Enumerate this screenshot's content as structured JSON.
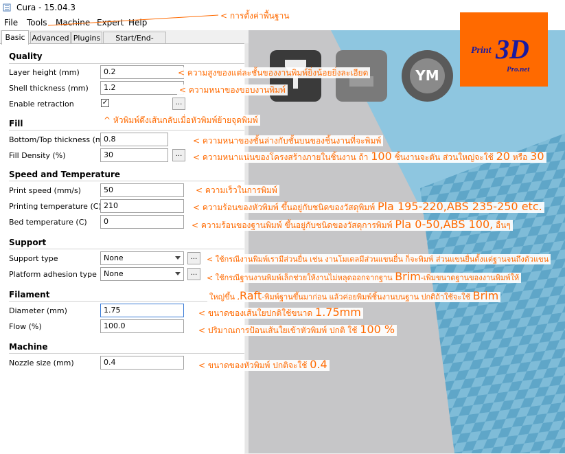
{
  "window": {
    "title": "Cura - 15.04.3"
  },
  "menu": [
    "File",
    "Tools",
    "Machine",
    "Expert",
    "Help"
  ],
  "tabs": [
    "Basic",
    "Advanced",
    "Plugins",
    "Start/End-GCode"
  ],
  "sections": {
    "quality": {
      "title": "Quality",
      "layer_height": {
        "label": "Layer height (mm)",
        "value": "0.2"
      },
      "shell_thickness": {
        "label": "Shell thickness (mm)",
        "value": "1.2"
      },
      "enable_retraction": {
        "label": "Enable retraction",
        "checked": true,
        "check_glyph": "✓"
      }
    },
    "fill": {
      "title": "Fill",
      "bottom_top": {
        "label": "Bottom/Top thickness (mm)",
        "value": "0.8"
      },
      "fill_density": {
        "label": "Fill Density (%)",
        "value": "30"
      }
    },
    "speed_temp": {
      "title": "Speed and Temperature",
      "print_speed": {
        "label": "Print speed (mm/s)",
        "value": "50"
      },
      "printing_temp": {
        "label": "Printing temperature (C)",
        "value": "210"
      },
      "bed_temp": {
        "label": "Bed temperature (C)",
        "value": "0"
      }
    },
    "support": {
      "title": "Support",
      "support_type": {
        "label": "Support type",
        "value": "None"
      },
      "platform_adhesion": {
        "label": "Platform adhesion type",
        "value": "None"
      }
    },
    "filament": {
      "title": "Filament",
      "diameter": {
        "label": "Diameter (mm)",
        "value": "1.75"
      },
      "flow": {
        "label": "Flow (%)",
        "value": "100.0"
      }
    },
    "machine": {
      "title": "Machine",
      "nozzle": {
        "label": "Nozzle size (mm)",
        "value": "0.4"
      }
    }
  },
  "buttons": {
    "dots": "..."
  },
  "viewport_buttons": {
    "ym": "YM"
  },
  "logo": {
    "line1": "Print",
    "big": "3D",
    "line2": "Pro.net"
  },
  "annotations": {
    "basic_settings": "< การตั้งค่าพื้นฐาน",
    "layer_height": "< ความสูงของแต่ละชั้นของงานพิมพ์ยิ่งน้อยยิ่งละเอียด",
    "shell_thickness": "< ความหนาของขอบงานพิมพ์",
    "retraction": "^ หัวพิมพ์ดึงเส้นกลับเมื่อหัวพิมพ์ย้ายจุดพิมพ์",
    "bottom_top": "< ความหนาของชั้นล่างกับชั้นบนของชิ้นงานที่จะพิมพ์",
    "fill_density_a": "< ความหนาแน่นของโครงสร้างภายในชิ้นงาน ถ้า ",
    "fill_density_b": "100",
    "fill_density_c": " ชิ้นงานจะตัน ส่วนใหญ่จะใช้ ",
    "fill_density_d": "20",
    "fill_density_e": " หรือ ",
    "fill_density_f": "30",
    "print_speed": "< ความเร็วในการพิมพ์",
    "printing_temp_a": "< ความร้อนของหัวพิมพ์ ขึ้นอยู่กับชนิดของวัสดุพิมพ์ ",
    "printing_temp_b": "Pla 195-220,ABS 235-250 etc.",
    "bed_temp_a": "< ความร้อนของฐานพิมพ์ ขึ้นอยู่กับชนิดของวัสดุการพิมพ์ ",
    "bed_temp_b": "Pla 0-50,ABS 100,",
    "bed_temp_c": " อื่นๆ",
    "support_type": "< ใช้กรณีงานพิมพ์เรามีส่วนยื่น เช่น งานโมเดลมีส่วนแขนยื่น ก็จะพิมพ์ ส่วนแขนยื่นตั้งแต่ฐานจนถึงตัวแขน",
    "adhesion_a": "< ใช้กรณีฐานงานพิมพ์เล็กช่วยให้งานไม่หลุดออกจากฐาน ",
    "adhesion_b": "Brim",
    "adhesion_c": "-เพิ่มขนาดฐานของงานพิมพ์ให้",
    "adhesion_d": "ใหญ่ขึ้น ,",
    "adhesion_e": "Raft",
    "adhesion_f": "-พิมพ์ฐานขึ้นมาก่อน แล้วค่อยพิมพ์ชิ้นงานบนฐาน ปกติถ้าใช้จะใช้ ",
    "adhesion_g": "Brim",
    "diameter_a": "< ขนาดของเส้นใยปกติใช้ขนาด ",
    "diameter_b": "1.75mm",
    "flow_a": "< ปริมาณการป้อนเส้นใยเข้าหัวพิมพ์ ปกติ ใช้ ",
    "flow_b": "100 %",
    "nozzle_a": "< ขนาดของหัวพิมพ์ ปกติจะใช้ ",
    "nozzle_b": "0.4"
  },
  "colors": {
    "annotation": "#ff6a00",
    "logo_bg": "#ff6a00",
    "logo_text": "#1a1aa0",
    "bed_blue": "#8ec6e0"
  }
}
